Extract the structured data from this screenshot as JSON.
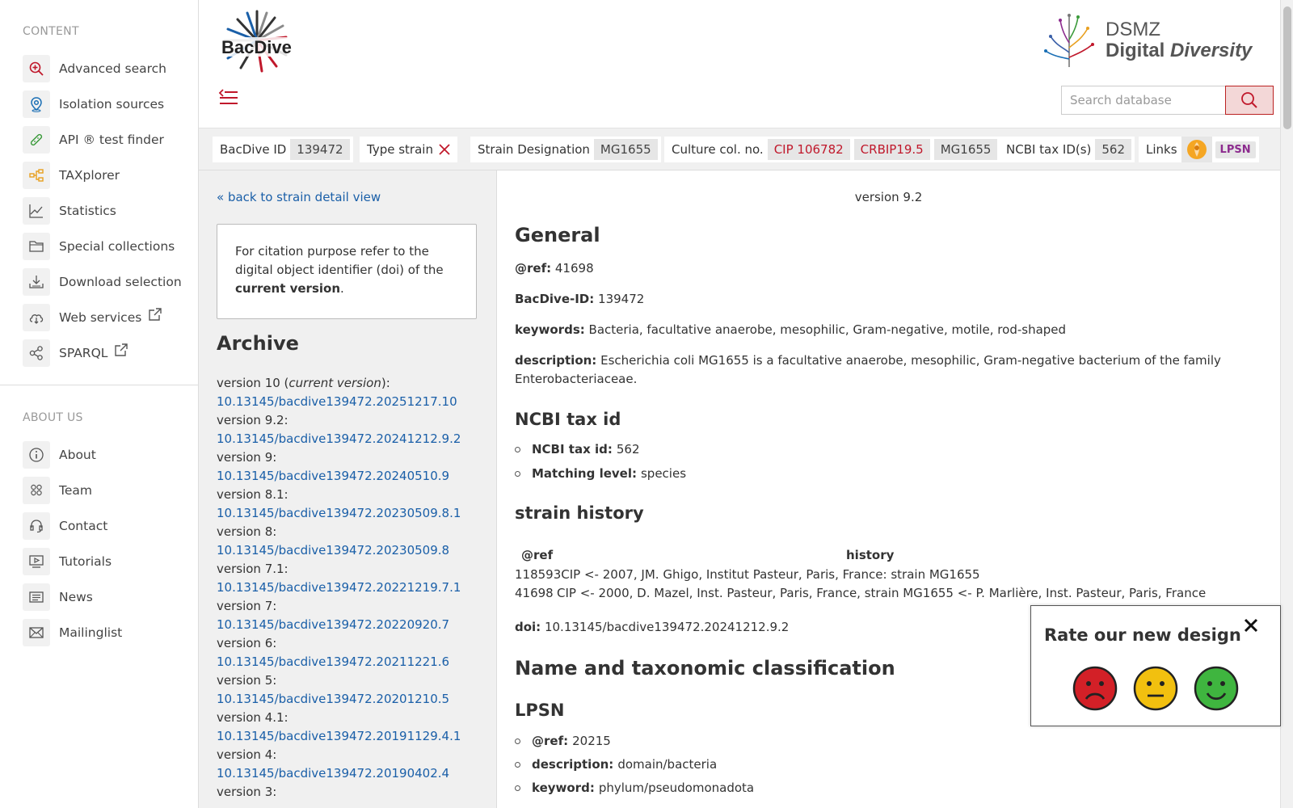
{
  "sidebar": {
    "content_title": "CONTENT",
    "about_title": "ABOUT US",
    "content_items": [
      {
        "label": "Advanced search",
        "icon": "zoom-in-icon"
      },
      {
        "label": "Isolation sources",
        "icon": "location-pin-icon"
      },
      {
        "label": "API ® test finder",
        "icon": "test-strip-icon"
      },
      {
        "label": "TAXplorer",
        "icon": "hierarchy-icon"
      },
      {
        "label": "Statistics",
        "icon": "line-chart-icon"
      },
      {
        "label": "Special collections",
        "icon": "folder-icon"
      },
      {
        "label": "Download selection",
        "icon": "download-icon"
      },
      {
        "label": "Web services",
        "icon": "cloud-download-icon"
      },
      {
        "label": "SPARQL",
        "icon": "share-graph-icon"
      }
    ],
    "about_items": [
      {
        "label": "About",
        "icon": "info-icon"
      },
      {
        "label": "Team",
        "icon": "team-icon"
      },
      {
        "label": "Contact",
        "icon": "headset-icon"
      },
      {
        "label": "Tutorials",
        "icon": "video-tutorial-icon"
      },
      {
        "label": "News",
        "icon": "newspaper-icon"
      },
      {
        "label": "Mailinglist",
        "icon": "envelope-icon"
      }
    ]
  },
  "header": {
    "logo_text": "BacDive",
    "dsmz_line1": "DSMZ",
    "dsmz_line2a": "Digital",
    "dsmz_line2b": "Diversity",
    "search_placeholder": "Search database"
  },
  "tagbar": {
    "bacdive_id_label": "BacDive ID",
    "bacdive_id": "139472",
    "type_strain_label": "Type strain",
    "strain_designation_label": "Strain Designation",
    "strain_designation": "MG1655",
    "culture_label": "Culture col. no.",
    "culture_1": "CIP 106782",
    "culture_2": "CRBIP19.5",
    "culture_3": "MG1655",
    "ncbi_label": "NCBI tax ID(s)",
    "ncbi_id": "562",
    "links_label": "Links",
    "lpsn": "LPSN"
  },
  "archive": {
    "back_link": "« back to strain detail view",
    "cite_1": "For citation purpose refer to the digital object identifier (doi) of the ",
    "cite_bold": "current version",
    "cite_end": ".",
    "title": "Archive",
    "versions": [
      {
        "label": "version 10 (",
        "italic": "current version",
        "tail": "):",
        "doi": "10.13145/bacdive139472.20251217.10"
      },
      {
        "label": "version 9.2:",
        "italic": "",
        "tail": "",
        "doi": "10.13145/bacdive139472.20241212.9.2"
      },
      {
        "label": "version 9:",
        "italic": "",
        "tail": "",
        "doi": "10.13145/bacdive139472.20240510.9"
      },
      {
        "label": "version 8.1:",
        "italic": "",
        "tail": "",
        "doi": "10.13145/bacdive139472.20230509.8.1"
      },
      {
        "label": "version 8:",
        "italic": "",
        "tail": "",
        "doi": "10.13145/bacdive139472.20230509.8"
      },
      {
        "label": "version 7.1:",
        "italic": "",
        "tail": "",
        "doi": "10.13145/bacdive139472.20221219.7.1"
      },
      {
        "label": "version 7:",
        "italic": "",
        "tail": "",
        "doi": "10.13145/bacdive139472.20220920.7"
      },
      {
        "label": "version 6:",
        "italic": "",
        "tail": "",
        "doi": "10.13145/bacdive139472.20211221.6"
      },
      {
        "label": "version 5:",
        "italic": "",
        "tail": "",
        "doi": "10.13145/bacdive139472.20201210.5"
      },
      {
        "label": "version 4.1:",
        "italic": "",
        "tail": "",
        "doi": "10.13145/bacdive139472.20191129.4.1"
      },
      {
        "label": "version 4:",
        "italic": "",
        "tail": "",
        "doi": "10.13145/bacdive139472.20190402.4"
      },
      {
        "label": "version 3:",
        "italic": "",
        "tail": "",
        "doi": ""
      }
    ]
  },
  "main": {
    "version": "version 9.2",
    "general_title": "General",
    "ref_label": "@ref:",
    "ref_value": "41698",
    "bacdive_id_label": "BacDive-ID:",
    "bacdive_id_value": "139472",
    "keywords_label": "keywords:",
    "keywords_value": "Bacteria, facultative anaerobe, mesophilic, Gram-negative, motile, rod-shaped",
    "description_label": "description:",
    "description_value": "Escherichia coli MG1655 is a facultative anaerobe, mesophilic, Gram-negative bacterium of the family Enterobacteriaceae.",
    "ncbi_title": "NCBI tax id",
    "ncbi_tax_label": "NCBI tax id:",
    "ncbi_tax_value": "562",
    "matching_label": "Matching level:",
    "matching_value": "species",
    "history_title": "strain history",
    "history_col_ref": "@ref",
    "history_col_history": "history",
    "history_rows": [
      {
        "ref": "118593",
        "text": "CIP <- 2007, JM. Ghigo, Institut Pasteur, Paris, France: strain MG1655"
      },
      {
        "ref": "41698",
        "text": "CIP <- 2000, D. Mazel, Inst. Pasteur, Paris, France, strain MG1655 <- P. Marlière, Inst. Pasteur, Paris, France"
      }
    ],
    "doi_label": "doi:",
    "doi_value": "10.13145/bacdive139472.20241212.9.2",
    "name_title": "Name and taxonomic classification",
    "lpsn_title": "LPSN",
    "lpsn_ref_label": "@ref:",
    "lpsn_ref_value": "20215",
    "lpsn_desc_label": "description:",
    "lpsn_desc_value": "domain/bacteria",
    "lpsn_kw_label": "keyword:",
    "lpsn_kw_value": "phylum/pseudomonadota"
  },
  "rating": {
    "title": "Rate our new design",
    "colors": {
      "sad": "#d32027",
      "neutral": "#f2c00f",
      "happy": "#3fb53f"
    }
  },
  "colors": {
    "accent_red": "#c0182b",
    "link_blue": "#1a5fa8"
  }
}
